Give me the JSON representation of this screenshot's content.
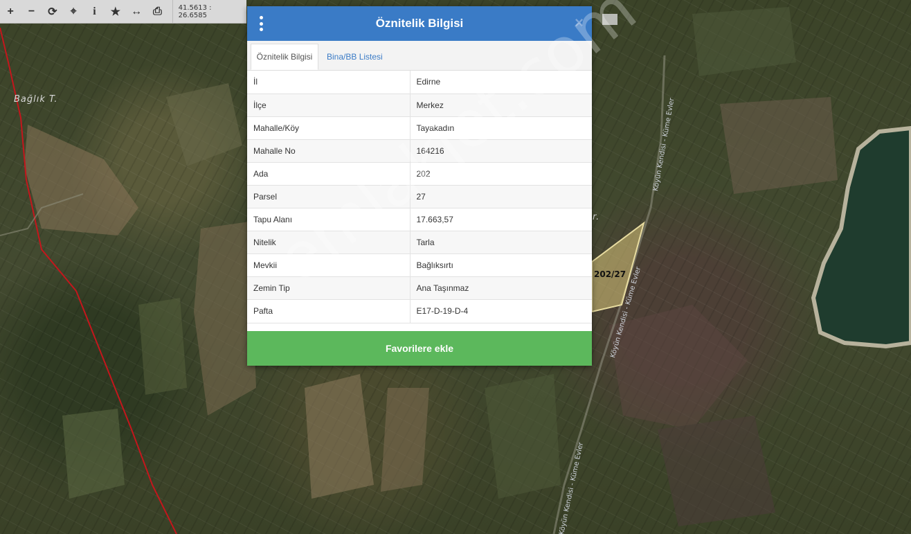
{
  "toolbar": {
    "tools": [
      {
        "name": "zoom-in-icon",
        "glyph": "+"
      },
      {
        "name": "zoom-out-icon",
        "glyph": "−"
      },
      {
        "name": "refresh-icon",
        "glyph": "⟳"
      },
      {
        "name": "locate-icon",
        "glyph": "⌖"
      },
      {
        "name": "info-icon",
        "glyph": "i"
      },
      {
        "name": "star-icon",
        "glyph": "★"
      },
      {
        "name": "measure-icon",
        "glyph": "↔"
      },
      {
        "name": "print-icon",
        "glyph": "⎙"
      }
    ],
    "coordinates": "41.5613 : 26.6585"
  },
  "map": {
    "place_label": "Bağlık T.",
    "parcel_label": "202/27",
    "road_label_1": "Köyün Kendisi - Küme Evler",
    "road_label_2": "Köyün Kendisi - Küme Evler",
    "road_label_3": "Köyün Kendisi - Küme Evler",
    "partial_label": "r."
  },
  "modal": {
    "title": "Öznitelik Bilgisi",
    "close_glyph": "×",
    "tabs": [
      {
        "label": "Öznitelik Bilgisi",
        "active": true
      },
      {
        "label": "Bina/BB Listesi",
        "active": false
      }
    ],
    "rows": [
      {
        "key": "İl",
        "value": "Edirne"
      },
      {
        "key": "İlçe",
        "value": "Merkez"
      },
      {
        "key": "Mahalle/Köy",
        "value": "Tayakadın"
      },
      {
        "key": "Mahalle No",
        "value": "164216"
      },
      {
        "key": "Ada",
        "value": "202"
      },
      {
        "key": "Parsel",
        "value": "27"
      },
      {
        "key": "Tapu Alanı",
        "value": "17.663,57"
      },
      {
        "key": "Nitelik",
        "value": "Tarla"
      },
      {
        "key": "Mevkii",
        "value": "Bağlıksırtı"
      },
      {
        "key": "Zemin Tip",
        "value": "Ana Taşınmaz"
      },
      {
        "key": "Pafta",
        "value": "E17-D-19-D-4"
      }
    ],
    "favorite_button": "Favorilere ekle"
  },
  "watermark": "emlakjet.com",
  "colors": {
    "header": "#3a7bc6",
    "button": "#5cb85c",
    "boundary": "#c4161c",
    "parcel": "#d9c77a"
  }
}
